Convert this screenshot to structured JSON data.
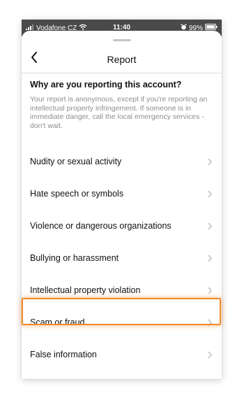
{
  "status_bar": {
    "carrier": "Vodafone CZ",
    "time": "11:40",
    "battery": "99%",
    "icons": [
      "signal-icon",
      "wifi-icon",
      "alarm-icon",
      "battery-icon"
    ]
  },
  "header": {
    "title": "Report",
    "back_icon": "back-chevron-icon"
  },
  "question": "Why are you reporting this account?",
  "note": "Your report is anonymous, except if you're reporting an intellectual property infringement. If someone is in immediate danger, call the local emergency services - don't wait.",
  "options": [
    {
      "label": "Nudity or sexual activity"
    },
    {
      "label": "Hate speech or symbols"
    },
    {
      "label": "Violence or dangerous organizations"
    },
    {
      "label": "Bullying or harassment"
    },
    {
      "label": "Intellectual property violation"
    },
    {
      "label": "Scam or fraud"
    },
    {
      "label": "False information"
    }
  ],
  "highlighted_option": "Scam or fraud",
  "colors": {
    "highlight": "#f28a2e",
    "status_bar": "#4a4a4c",
    "note_text": "#8e8e8e",
    "chevron": "#b0b0b0"
  }
}
